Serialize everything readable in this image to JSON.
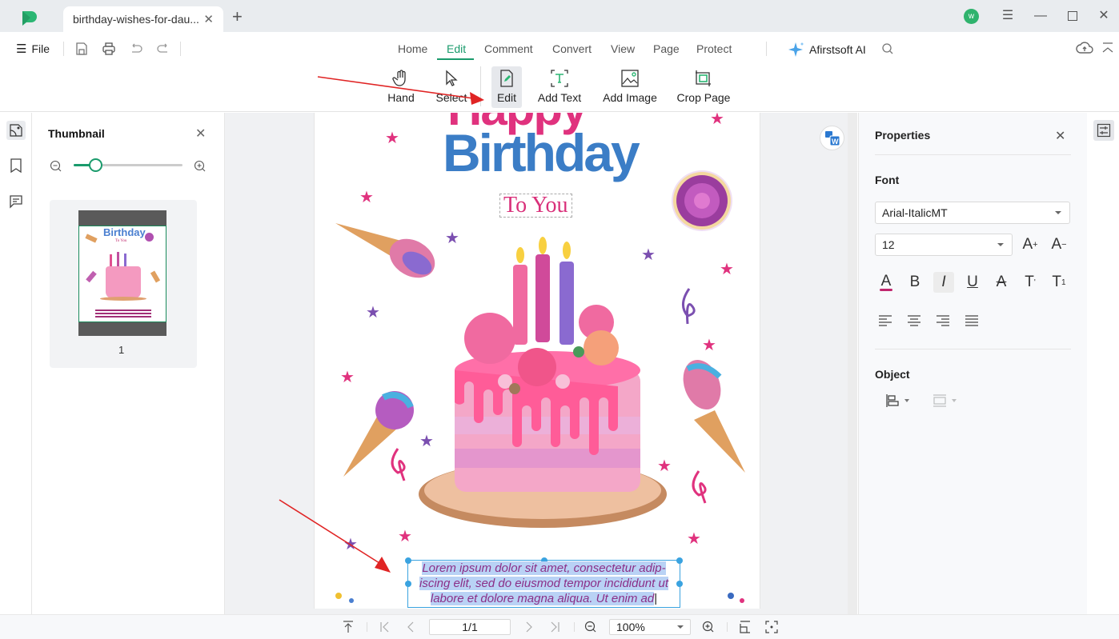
{
  "titlebar": {
    "tab_title": "birthday-wishes-for-dau...",
    "avatar_initial": "w"
  },
  "menubar": {
    "file_label": "File",
    "tabs": [
      {
        "label": "Home",
        "active": false
      },
      {
        "label": "Edit",
        "active": true
      },
      {
        "label": "Comment",
        "active": false
      },
      {
        "label": "Convert",
        "active": false
      },
      {
        "label": "View",
        "active": false
      },
      {
        "label": "Page",
        "active": false
      },
      {
        "label": "Protect",
        "active": false
      }
    ],
    "ai_label": "Afirstsoft AI"
  },
  "ribbon": {
    "tools": [
      {
        "label": "Hand",
        "icon": "hand-icon"
      },
      {
        "label": "Select",
        "icon": "cursor-icon"
      },
      {
        "label": "Edit",
        "icon": "edit-icon",
        "selected": true
      },
      {
        "label": "Add Text",
        "icon": "add-text-icon"
      },
      {
        "label": "Add Image",
        "icon": "add-image-icon"
      },
      {
        "label": "Crop Page",
        "icon": "crop-icon"
      }
    ]
  },
  "thumbnail_panel": {
    "title": "Thumbnail",
    "zoom_slider_fraction": 0.2,
    "pages": [
      {
        "number": "1"
      }
    ]
  },
  "document": {
    "title_line1": "Happy",
    "title_line2": "Birthday",
    "subtitle": "To You",
    "selected_text_lines": [
      "Lorem ipsum dolor sit amet, consectetur adip-",
      "iscing elit, sed do eiusmod tempor incididunt ut",
      "labore et dolore magna aliqua. Ut enim ad"
    ]
  },
  "properties": {
    "title": "Properties",
    "font_section": "Font",
    "font_family": "Arial-ItalicMT",
    "font_size": "12",
    "object_section": "Object",
    "colors": {
      "font_color_underline": "#c0266d",
      "accent": "#1a9b6c"
    }
  },
  "bottombar": {
    "page_indicator": "1/1",
    "zoom_level": "100%"
  }
}
